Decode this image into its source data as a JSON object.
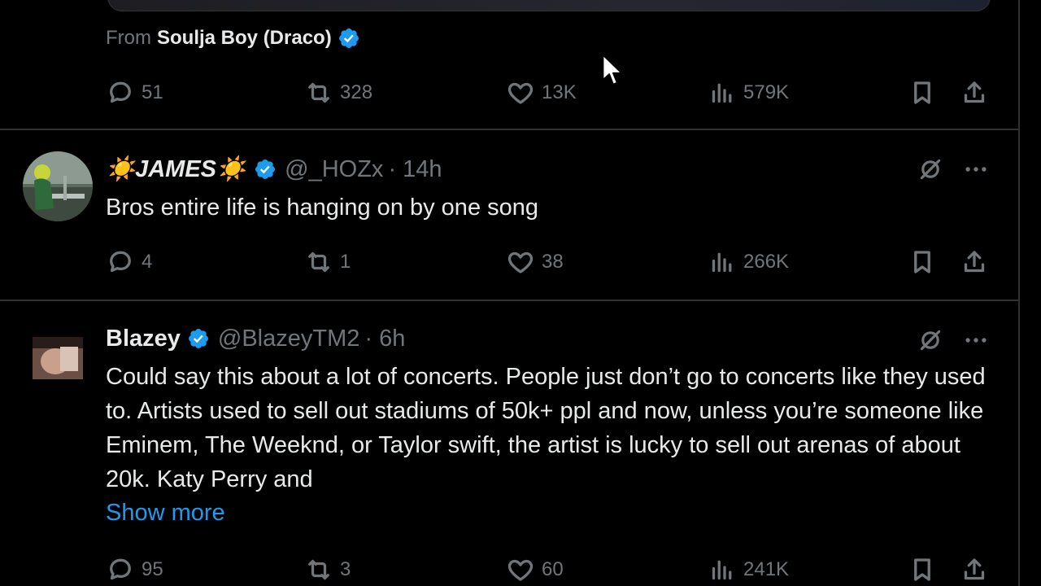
{
  "top_post": {
    "source_prefix": "From",
    "source_name": "Soulja Boy (Draco)",
    "stats": {
      "replies": "51",
      "reposts": "328",
      "likes": "13K",
      "views": "579K"
    }
  },
  "replies": [
    {
      "name": "☀️JAMES☀️",
      "handle": "@_HOZx",
      "time": "· 14h",
      "text": "Bros entire life is hanging on by one song",
      "stats": {
        "replies": "4",
        "reposts": "1",
        "likes": "38",
        "views": "266K"
      }
    },
    {
      "name": "Blazey",
      "handle": "@BlazeyTM2",
      "time": "· 6h",
      "text": "Could say this about a lot of concerts. People just don’t go to concerts like they used to. Artists used to sell out stadiums of 50k+ ppl and now, unless you’re someone like Eminem, The Weeknd, or Taylor swift, the artist is lucky to sell out arenas of about 20k. Katy Perry and",
      "show_more": "Show more",
      "stats": {
        "replies": "95",
        "reposts": "3",
        "likes": "60",
        "views": "241K"
      }
    }
  ],
  "colors": {
    "accent": "#1d9bf0",
    "muted": "#71767b",
    "text": "#e7e9ea",
    "border": "#2f3336"
  }
}
